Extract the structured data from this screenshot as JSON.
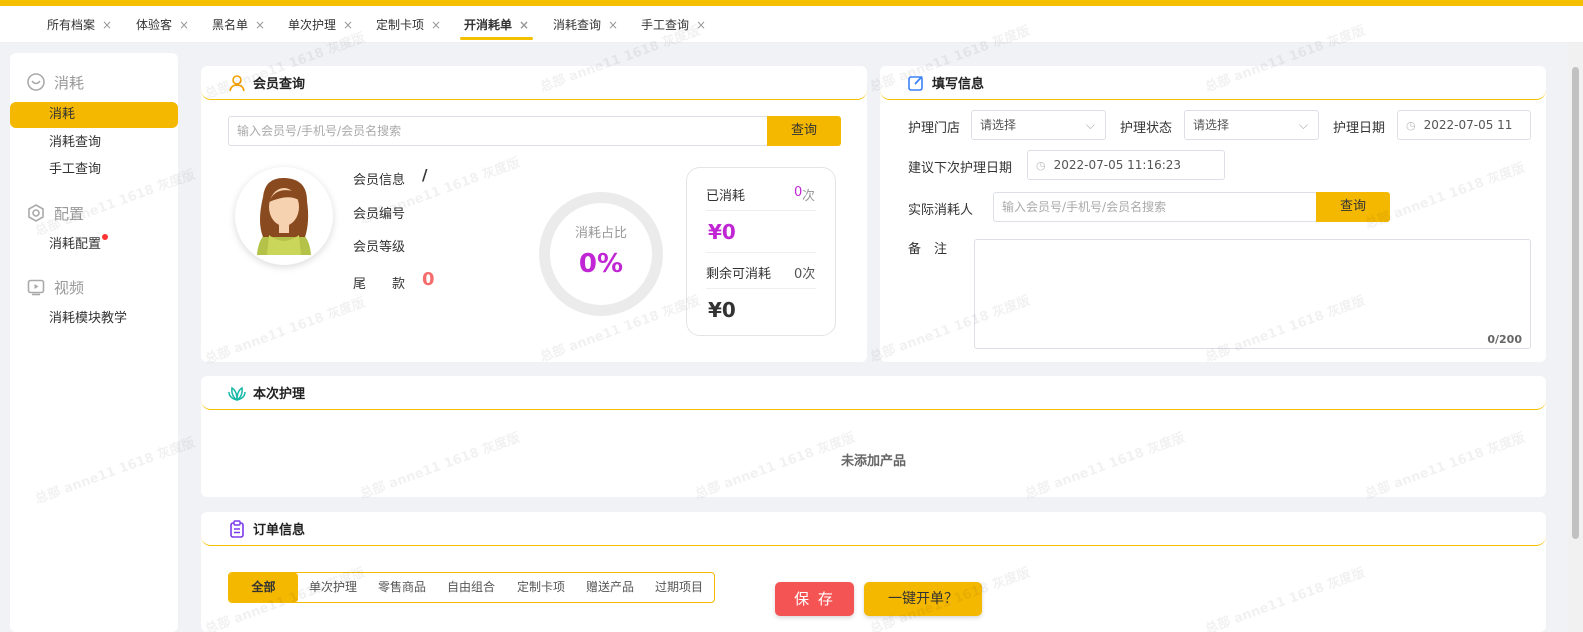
{
  "tabs": [
    {
      "label": "所有档案",
      "close": "×"
    },
    {
      "label": "体验客",
      "close": "×"
    },
    {
      "label": "黑名单",
      "close": "×"
    },
    {
      "label": "单次护理",
      "close": "×"
    },
    {
      "label": "定制卡项",
      "close": "×"
    },
    {
      "label": "开消耗单",
      "close": "×"
    },
    {
      "label": "消耗查询",
      "close": "×"
    },
    {
      "label": "手工查询",
      "close": "×"
    }
  ],
  "sidebar": {
    "sections": [
      {
        "title": "消耗",
        "icon": "smile-circle-icon"
      },
      {
        "title": "配置",
        "icon": "hexagon-settings-icon"
      },
      {
        "title": "视频",
        "icon": "video-play-icon"
      }
    ],
    "items": [
      {
        "label": "消耗"
      },
      {
        "label": "消耗查询"
      },
      {
        "label": "手工查询"
      },
      {
        "label": "消耗配置"
      },
      {
        "label": "消耗模块教学"
      }
    ]
  },
  "member_query": {
    "title": "会员查询",
    "search_placeholder": "输入会员号/手机号/会员名搜索",
    "search_button": "查询",
    "info_label": "会员信息",
    "info_value": "/",
    "number_label": "会员编号",
    "level_label": "会员等级",
    "balance_label": "尾　　款",
    "balance_value": "0",
    "ratio_label": "消耗占比",
    "ratio_value": "0%",
    "consumed_label": "已消耗",
    "consumed_count": "0",
    "consumed_unit": "次",
    "consumed_amount": "¥0",
    "remaining_label": "剩余可消耗",
    "remaining_count": "0次",
    "remaining_amount": "¥0"
  },
  "fill_info": {
    "title": "填写信息",
    "store_label": "护理门店",
    "store_value": "请选择",
    "status_label": "护理状态",
    "status_value": "请选择",
    "date_label": "护理日期",
    "date_value": "2022-07-05 11",
    "next_date_label": "建议下次护理日期",
    "next_date_value": "2022-07-05 11:16:23",
    "consumer_label": "实际消耗人",
    "consumer_placeholder": "输入会员号/手机号/会员名搜索",
    "consumer_button": "查询",
    "remark_label": "备　注",
    "remark_count": "0/200"
  },
  "care": {
    "title": "本次护理",
    "empty_text": "未添加产品"
  },
  "order": {
    "title": "订单信息",
    "filters": [
      "全部",
      "单次护理",
      "零售商品",
      "自由组合",
      "定制卡项",
      "赠送产品",
      "过期项目"
    ],
    "save_button": "保 存",
    "quick_button": "一键开单？"
  },
  "watermark": "总部 anne11 1618 灰度版",
  "colors": {
    "accent": "#f5b800",
    "danger": "#f56c6c",
    "purple": "#c026d3"
  }
}
